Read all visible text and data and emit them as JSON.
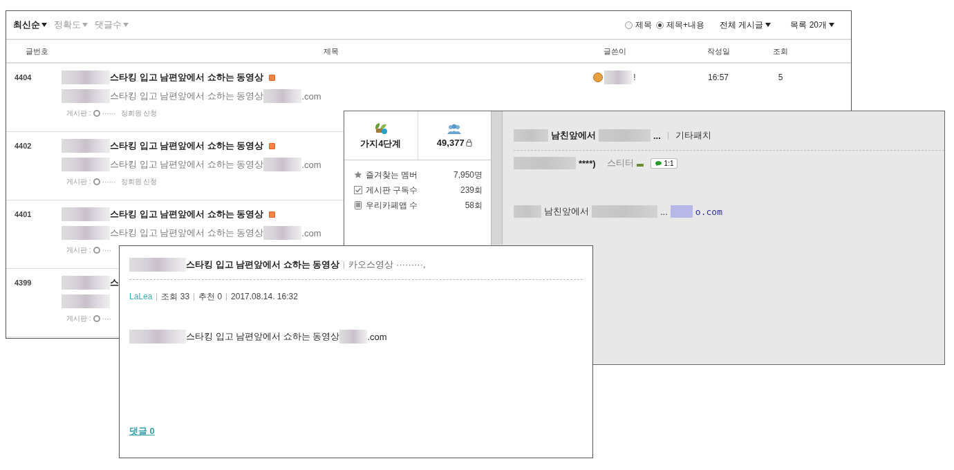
{
  "list_panel": {
    "sort_options": [
      {
        "label": "최신순",
        "selected": true
      },
      {
        "label": "정확도",
        "selected": false
      },
      {
        "label": "댓글수",
        "selected": false
      }
    ],
    "search_scope": [
      {
        "label": "제목",
        "selected": false
      },
      {
        "label": "제목+내용",
        "selected": true
      }
    ],
    "filters": [
      "전체 게시글",
      "목록 20개"
    ],
    "columns": [
      "글번호",
      "제목",
      "글쓴이",
      "작성일",
      "조회"
    ],
    "rows": [
      {
        "number": "4404",
        "title": "스타킹 입고 남편앞에서 쇼하는 동영상",
        "new": true,
        "summary": "스타킹 입고 남편앞에서 쇼하는 동영상",
        "summary_end": ".com",
        "board_label": "게시판 :",
        "board_dots": "······",
        "board_name": "정회원 신청",
        "author": "!",
        "time": "16:57",
        "views": "5"
      },
      {
        "number": "4402",
        "title": "스타킹 입고 남편앞에서 쇼하는 동영상",
        "new": true,
        "summary": "스타킹 입고 남편앞에서 쇼하는 동영상",
        "summary_end": ".com",
        "board_label": "게시판 :",
        "board_dots": "······",
        "board_name": "정회원 신청"
      },
      {
        "number": "4401",
        "title": "스타킹 입고 남편앞에서 쇼하는 동영상",
        "new": true,
        "summary": "스타킹 입고 남편앞에서 쇼하는 동영상",
        "summary_end": ".com",
        "board_label": "게시판 :",
        "board_dots": "····"
      },
      {
        "number": "4399",
        "title": "스",
        "new": false,
        "board_label": "게시판 :",
        "board_dots": "····"
      }
    ]
  },
  "cafe_panel": {
    "level": "가지4단계",
    "members": "49,377",
    "stats": [
      {
        "kind": "star",
        "label": "즐겨찾는 멤버",
        "value": "7,950명"
      },
      {
        "kind": "check",
        "label": "게시판 구독수",
        "value": "239회"
      },
      {
        "kind": "phone",
        "label": "우리카페앱 수",
        "value": "58회"
      }
    ],
    "post_title": "남친앞에서",
    "post_title_end": "...",
    "category": "기타패치",
    "author_tail": "****)",
    "author_level": "스티터",
    "chat_badge": "1:1",
    "body": "남친앞에서",
    "body_mid": "...",
    "body_link": "o.com"
  },
  "post_panel": {
    "title": "스타킹 입고 남편앞에서 쇼하는 동영상",
    "category": "카오스영상 ·········,",
    "author": "LaLea",
    "views": "조회 33",
    "likes": "추천 0",
    "date": "2017.08.14. 16:32",
    "body": "스타킹 입고 남편앞에서 쇼하는 동영상",
    "body_end": ".com",
    "comments": "댓글 0"
  }
}
